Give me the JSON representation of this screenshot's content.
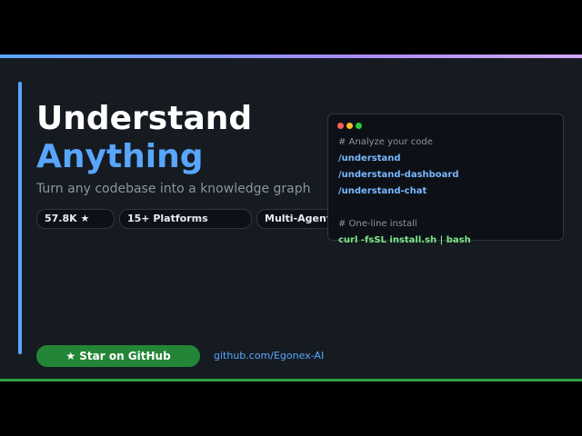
{
  "hero": {
    "title_line1": "Understand",
    "title_line2": "Anything",
    "subtitle": "Turn any codebase into a knowledge graph"
  },
  "badges": [
    {
      "label": "57.8K ★"
    },
    {
      "label": "15+ Platforms"
    },
    {
      "label": "Multi-Agent"
    }
  ],
  "code_window": {
    "lines": [
      {
        "kind": "comment",
        "text": "# Analyze your code"
      },
      {
        "kind": "command",
        "text": "/understand"
      },
      {
        "kind": "command",
        "text": "/understand-dashboard"
      },
      {
        "kind": "command",
        "text": "/understand-chat"
      },
      {
        "kind": "comment",
        "text": "# One-line install"
      },
      {
        "kind": "install",
        "text": "curl -fsSL install.sh | bash"
      }
    ]
  },
  "cta": {
    "star_label": "★ Star on GitHub",
    "repo_link": "github.com/Egonex-AI"
  },
  "colors": {
    "background": "#161b22",
    "accent_blue": "#58a6ff",
    "accent_green": "#238636",
    "window_dot_red": "#ff5f57",
    "window_dot_yellow": "#febc2e",
    "window_dot_green": "#28c840"
  }
}
